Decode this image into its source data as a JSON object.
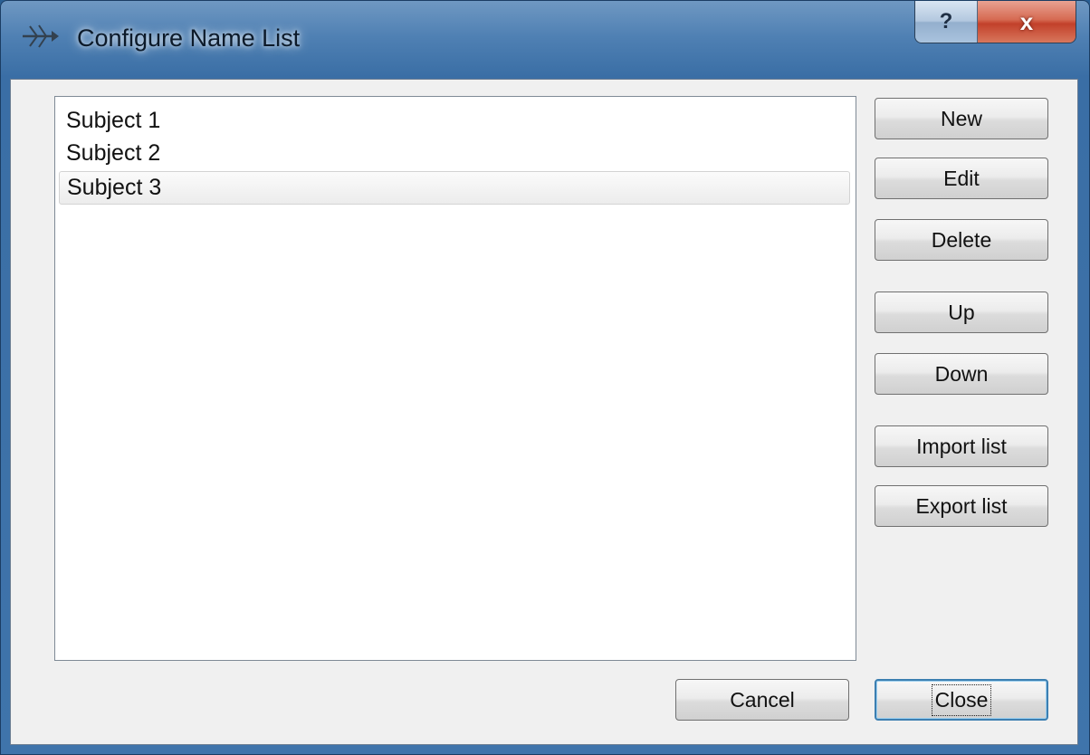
{
  "window": {
    "title": "Configure Name List",
    "app_icon": "fishbone-icon",
    "help_label": "?",
    "close_label": "x"
  },
  "list": {
    "items": [
      {
        "label": "Subject 1",
        "selected": false
      },
      {
        "label": "Subject 2",
        "selected": false
      },
      {
        "label": "Subject 3",
        "selected": true
      }
    ]
  },
  "buttons": {
    "new": "New",
    "edit": "Edit",
    "delete": "Delete",
    "up": "Up",
    "down": "Down",
    "import": "Import list",
    "export": "Export list",
    "cancel": "Cancel",
    "close": "Close"
  },
  "colors": {
    "titlebar": "#4f80b3",
    "close_button": "#c2402a",
    "dialog_background": "#f0f0f0",
    "default_button_border": "#3c7fb1"
  }
}
